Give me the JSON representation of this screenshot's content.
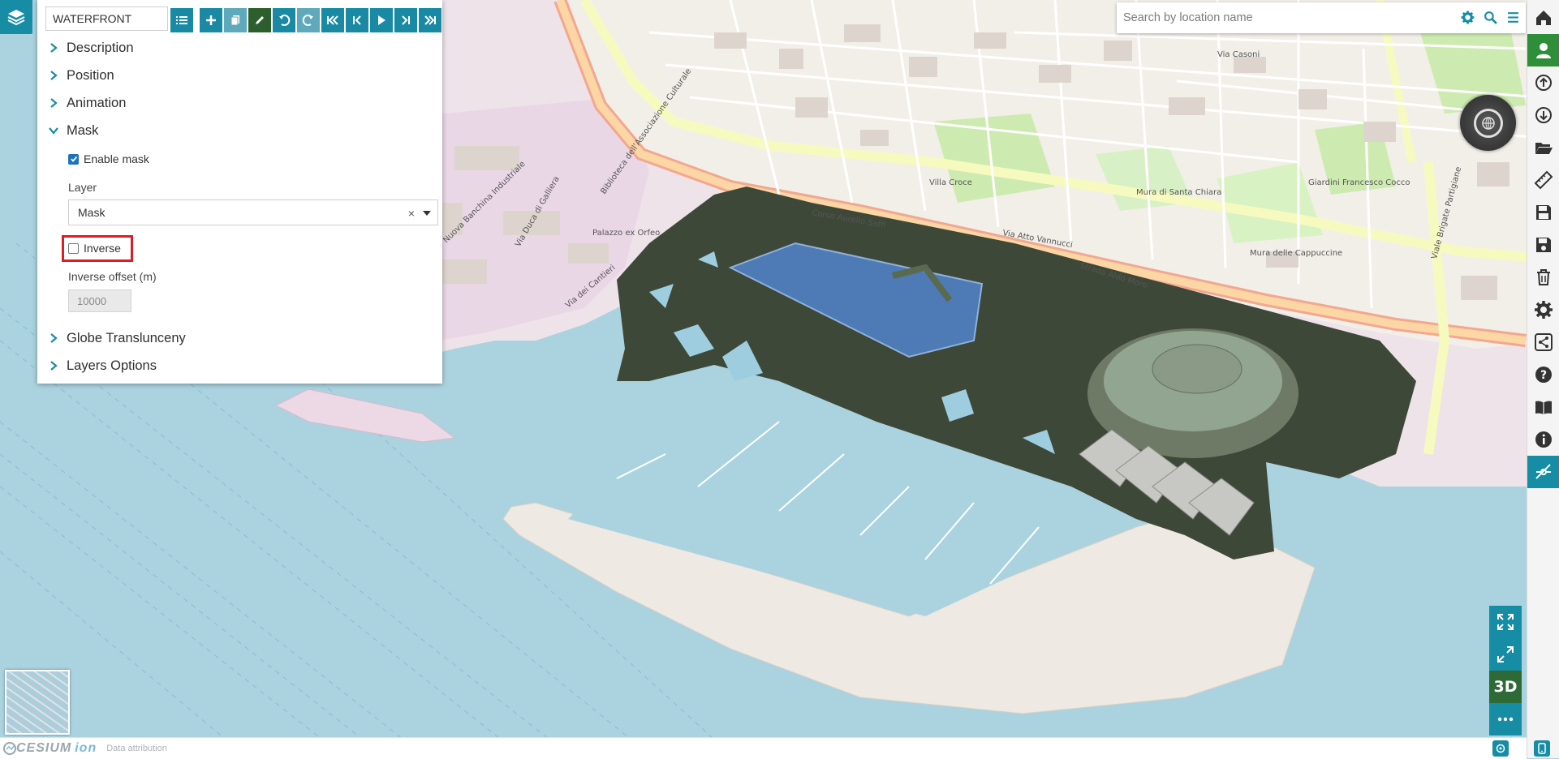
{
  "panel": {
    "name_value": "WATERFRONT",
    "sections": {
      "description": "Description",
      "position": "Position",
      "animation": "Animation",
      "mask": "Mask",
      "globe_translucency": "Globe Translunceny",
      "layers_options": "Layers Options"
    },
    "mask": {
      "enable_label": "Enable mask",
      "enable_checked": true,
      "layer_label": "Layer",
      "layer_value": "Mask",
      "clear_symbol": "×",
      "inverse_label": "Inverse",
      "inverse_checked": false,
      "inverse_offset_label": "Inverse offset (m)",
      "inverse_offset_value": "10000"
    },
    "toolbar_icons": [
      "list-icon",
      "plus-icon",
      "copy-icon",
      "edit-icon",
      "undo-icon",
      "redo-icon",
      "first-icon",
      "prev-icon",
      "play-icon",
      "next-icon",
      "last-icon"
    ]
  },
  "search": {
    "placeholder": "Search by location name"
  },
  "right_toolbar": [
    "home-icon",
    "user-icon",
    "upload-icon",
    "download-icon",
    "folder-open-icon",
    "ruler-icon",
    "save-icon",
    "save-as-icon",
    "trash-icon",
    "gear-icon",
    "share-icon",
    "help-icon",
    "book-icon",
    "info-icon",
    "tools-icon"
  ],
  "view_controls": {
    "mode_label": "3D"
  },
  "footer": {
    "cesium": "CESIUM",
    "ion": "ion",
    "attribution": "Data attribution"
  },
  "map_labels": {
    "street1": "Strada Aldo Moro",
    "street2": "Corso Aurelio Saffi",
    "street3": "Via Atto Vannucci",
    "street4": "Via Duca di Galliera",
    "street5": "Nuova Banchina Industriale",
    "street6": "Via dei Cantieri",
    "street7": "Viale Brigate Partigiane",
    "street8": "Via Casoni",
    "poi1": "Biblioteca dell'Associazione Culturale",
    "poi2": "Palazzo ex Orfeo",
    "poi3": "Villa Croce",
    "poi4": "Giardini Francesco Cocco",
    "poi5": "Mura delle Cappuccine",
    "poi6": "Mura di Santa Chiara"
  },
  "colors": {
    "accent": "#178da5",
    "green": "#2f8e3a",
    "highlight": "#e01b24",
    "water": "#aad3df"
  }
}
